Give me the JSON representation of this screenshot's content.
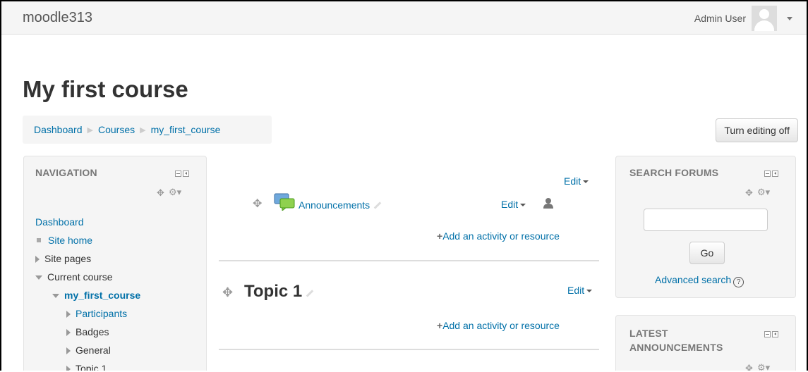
{
  "navbar": {
    "site_name": "moodle313",
    "user_name": "Admin User"
  },
  "page": {
    "title": "My first course",
    "edit_button": "Turn editing off"
  },
  "breadcrumb": [
    "Dashboard",
    "Courses",
    "my_first_course"
  ],
  "navigation": {
    "title": "NAVIGATION",
    "items": [
      "Dashboard",
      "Site home",
      "Site pages",
      "Current course",
      "my_first_course",
      "Participants",
      "Badges",
      "General",
      "Topic 1"
    ]
  },
  "course": {
    "section0": {
      "edit": "Edit",
      "activity_name": "Announcements",
      "activity_edit": "Edit",
      "add_activity": "Add an activity or resource"
    },
    "section1": {
      "title": "Topic 1",
      "edit": "Edit",
      "add_activity": "Add an activity or resource"
    }
  },
  "search_forums": {
    "title": "SEARCH FORUMS",
    "go_label": "Go",
    "advanced_search": "Advanced search",
    "help": "?"
  },
  "latest_announcements": {
    "title_line1": "LATEST",
    "title_line2": "ANNOUNCEMENTS"
  },
  "colors": {
    "link": "#0070a8",
    "block_bg": "#f5f5f5"
  }
}
